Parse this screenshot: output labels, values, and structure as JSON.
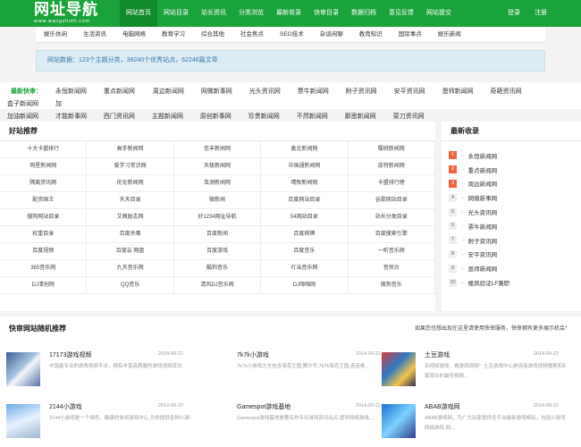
{
  "header": {
    "logo_main": "网址导航",
    "logo_sub": "www.wangzhidh.com",
    "nav": [
      "网站首页",
      "网站目录",
      "站长资讯",
      "分类浏览",
      "最新收录",
      "快审目录",
      "数据归档",
      "意见反馈",
      "网站提交"
    ],
    "login": "登录",
    "register": "注册"
  },
  "subnav": [
    "娱乐休闲",
    "生活资讯",
    "电脑网络",
    "教育学习",
    "综合其他",
    "社会焦点",
    "SEO技术",
    "杂谈闲聊",
    "教育知识",
    "国际事点",
    "娱乐新闻"
  ],
  "stats": "网站数据：123个主题分类，38240个优秀站点，62246篇文章",
  "quick": {
    "label": "最新快审：",
    "links": [
      "永恒新闻网",
      "重点新闻网",
      "周边新闻网",
      "网微新事网",
      "光头资讯网",
      "票牛新闻网",
      "附子资讯网",
      "安平资讯网",
      "恩师新闻网",
      "奇葩资讯网",
      "盒子新闻网",
      "加油新闻网",
      "才能新事网",
      "西门资讯网",
      "主题新闻网",
      "原创新事网",
      "珍贵新闻网",
      "不然新闻网",
      "那思新闻网",
      "菜刀资讯网"
    ]
  },
  "recommend": {
    "title": "好站推荐",
    "items": [
      "十大卡盟排行",
      "高手新闻网",
      "信丰新闻网",
      "盍北新闻网",
      "樱桃新闻网",
      "明星新闻网",
      "爱学习常识网",
      "天极新闻网",
      "中国通新闻网",
      "皮特新闻网",
      "隔离资讯网",
      "优化新闻网",
      "虫洞新闻网",
      "晴牧新闻网",
      "卡盟排行榜",
      "配资国王",
      "天天目录",
      "微新闻",
      "百度网站目录",
      "谷歌网站目录",
      "搜狗网站目录",
      "艾薇励志网",
      "好1234网址导航",
      "54网站目录",
      "站长分类目录",
      "权重目录",
      "百度杀毒",
      "百度新闻",
      "百度棋牌",
      "百度搜索引擎",
      "百度视频",
      "百度云 网盘",
      "百度游戏",
      "百度音乐",
      "一听音乐网",
      "365音乐网",
      "九天音乐网",
      "酷狗音乐",
      "叮当音乐网",
      "音悦台",
      "DJ清创网",
      "QQ音乐",
      "清风DJ音乐网",
      "DJ嗨嗨网",
      "搜狗音乐"
    ]
  },
  "latest": {
    "title": "最新收录",
    "items": [
      {
        "num": "1",
        "name": "永恒新闻网"
      },
      {
        "num": "2",
        "name": "重点新闻网"
      },
      {
        "num": "3",
        "name": "周边新闻网"
      },
      {
        "num": "4",
        "name": "网微新事网"
      },
      {
        "num": "5",
        "name": "光头资讯网"
      },
      {
        "num": "6",
        "name": "票牛新闻网"
      },
      {
        "num": "7",
        "name": "附子资讯网"
      },
      {
        "num": "8",
        "name": "安平资讯网"
      },
      {
        "num": "9",
        "name": "恩师新闻网"
      },
      {
        "num": "10",
        "name": "楼凤验证LF兼职"
      }
    ]
  },
  "random": {
    "title": "快审网站随机推荐",
    "hint": "如果您也想出现在这里请使用快审服务，快审拥有更多展示机会！",
    "cards": [
      {
        "title": "17173游戏视频",
        "date": "2014-09-22",
        "desc": "中国最专业的游戏视频平台，拥有丰富高质量的游戏视频资讯",
        "desc2": ""
      },
      {
        "title": "7k7k小游戏",
        "date": "2014-09-22",
        "desc": "7k7k小游戏大全包含海克王国,赛尔号,7k7k海克王国,连连看...",
        "desc2": ""
      },
      {
        "title": "土豆游戏",
        "date": "2014-09-22",
        "desc": "玩视频游戏，看游戏视频！土豆游戏中心是连接游戏视频播客和玩",
        "desc2": "家观众的最佳视频..."
      },
      {
        "title": "2144小游戏",
        "date": "2014-09-22",
        "desc": "2144小游戏是一个绿色、健康的休闲游戏中心,为你提供各种小游戏,动作类,...",
        "desc2": ""
      },
      {
        "title": "Gamespot游戏基地",
        "date": "2014-09-22",
        "desc": "Gamespot游戏基地是著名的专业游戏资讯站点,提供网络游戏,...",
        "desc2": ""
      },
      {
        "title": "ABAB游戏网",
        "date": "2014-09-22",
        "desc": "ABAB游戏网，为广大玩家提供全平台最新游戏畅玩，包括小游戏、",
        "desc2": "网络游戏,网..."
      }
    ]
  }
}
